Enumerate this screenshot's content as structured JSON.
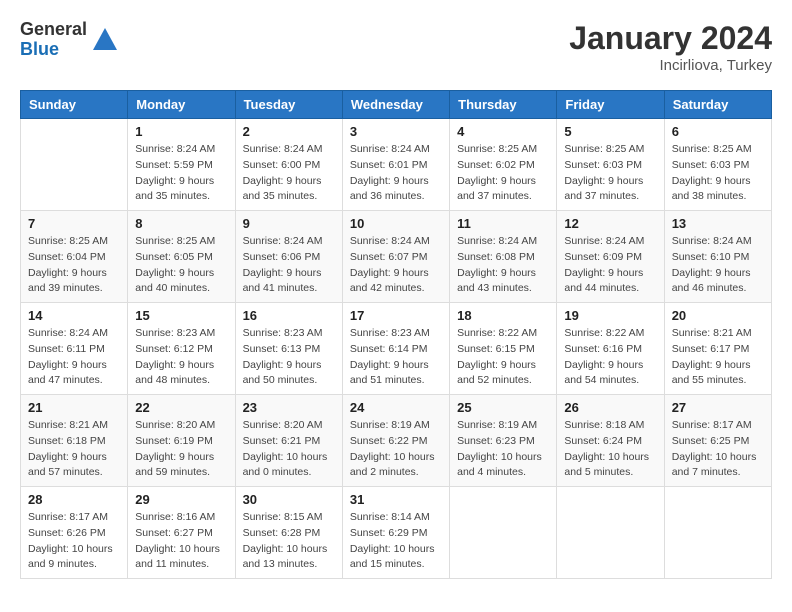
{
  "header": {
    "logo_general": "General",
    "logo_blue": "Blue",
    "month_year": "January 2024",
    "location": "Incirliova, Turkey"
  },
  "weekdays": [
    "Sunday",
    "Monday",
    "Tuesday",
    "Wednesday",
    "Thursday",
    "Friday",
    "Saturday"
  ],
  "weeks": [
    [
      {
        "day": "",
        "detail": ""
      },
      {
        "day": "1",
        "detail": "Sunrise: 8:24 AM\nSunset: 5:59 PM\nDaylight: 9 hours\nand 35 minutes."
      },
      {
        "day": "2",
        "detail": "Sunrise: 8:24 AM\nSunset: 6:00 PM\nDaylight: 9 hours\nand 35 minutes."
      },
      {
        "day": "3",
        "detail": "Sunrise: 8:24 AM\nSunset: 6:01 PM\nDaylight: 9 hours\nand 36 minutes."
      },
      {
        "day": "4",
        "detail": "Sunrise: 8:25 AM\nSunset: 6:02 PM\nDaylight: 9 hours\nand 37 minutes."
      },
      {
        "day": "5",
        "detail": "Sunrise: 8:25 AM\nSunset: 6:03 PM\nDaylight: 9 hours\nand 37 minutes."
      },
      {
        "day": "6",
        "detail": "Sunrise: 8:25 AM\nSunset: 6:03 PM\nDaylight: 9 hours\nand 38 minutes."
      }
    ],
    [
      {
        "day": "7",
        "detail": "Sunrise: 8:25 AM\nSunset: 6:04 PM\nDaylight: 9 hours\nand 39 minutes."
      },
      {
        "day": "8",
        "detail": "Sunrise: 8:25 AM\nSunset: 6:05 PM\nDaylight: 9 hours\nand 40 minutes."
      },
      {
        "day": "9",
        "detail": "Sunrise: 8:24 AM\nSunset: 6:06 PM\nDaylight: 9 hours\nand 41 minutes."
      },
      {
        "day": "10",
        "detail": "Sunrise: 8:24 AM\nSunset: 6:07 PM\nDaylight: 9 hours\nand 42 minutes."
      },
      {
        "day": "11",
        "detail": "Sunrise: 8:24 AM\nSunset: 6:08 PM\nDaylight: 9 hours\nand 43 minutes."
      },
      {
        "day": "12",
        "detail": "Sunrise: 8:24 AM\nSunset: 6:09 PM\nDaylight: 9 hours\nand 44 minutes."
      },
      {
        "day": "13",
        "detail": "Sunrise: 8:24 AM\nSunset: 6:10 PM\nDaylight: 9 hours\nand 46 minutes."
      }
    ],
    [
      {
        "day": "14",
        "detail": "Sunrise: 8:24 AM\nSunset: 6:11 PM\nDaylight: 9 hours\nand 47 minutes."
      },
      {
        "day": "15",
        "detail": "Sunrise: 8:23 AM\nSunset: 6:12 PM\nDaylight: 9 hours\nand 48 minutes."
      },
      {
        "day": "16",
        "detail": "Sunrise: 8:23 AM\nSunset: 6:13 PM\nDaylight: 9 hours\nand 50 minutes."
      },
      {
        "day": "17",
        "detail": "Sunrise: 8:23 AM\nSunset: 6:14 PM\nDaylight: 9 hours\nand 51 minutes."
      },
      {
        "day": "18",
        "detail": "Sunrise: 8:22 AM\nSunset: 6:15 PM\nDaylight: 9 hours\nand 52 minutes."
      },
      {
        "day": "19",
        "detail": "Sunrise: 8:22 AM\nSunset: 6:16 PM\nDaylight: 9 hours\nand 54 minutes."
      },
      {
        "day": "20",
        "detail": "Sunrise: 8:21 AM\nSunset: 6:17 PM\nDaylight: 9 hours\nand 55 minutes."
      }
    ],
    [
      {
        "day": "21",
        "detail": "Sunrise: 8:21 AM\nSunset: 6:18 PM\nDaylight: 9 hours\nand 57 minutes."
      },
      {
        "day": "22",
        "detail": "Sunrise: 8:20 AM\nSunset: 6:19 PM\nDaylight: 9 hours\nand 59 minutes."
      },
      {
        "day": "23",
        "detail": "Sunrise: 8:20 AM\nSunset: 6:21 PM\nDaylight: 10 hours\nand 0 minutes."
      },
      {
        "day": "24",
        "detail": "Sunrise: 8:19 AM\nSunset: 6:22 PM\nDaylight: 10 hours\nand 2 minutes."
      },
      {
        "day": "25",
        "detail": "Sunrise: 8:19 AM\nSunset: 6:23 PM\nDaylight: 10 hours\nand 4 minutes."
      },
      {
        "day": "26",
        "detail": "Sunrise: 8:18 AM\nSunset: 6:24 PM\nDaylight: 10 hours\nand 5 minutes."
      },
      {
        "day": "27",
        "detail": "Sunrise: 8:17 AM\nSunset: 6:25 PM\nDaylight: 10 hours\nand 7 minutes."
      }
    ],
    [
      {
        "day": "28",
        "detail": "Sunrise: 8:17 AM\nSunset: 6:26 PM\nDaylight: 10 hours\nand 9 minutes."
      },
      {
        "day": "29",
        "detail": "Sunrise: 8:16 AM\nSunset: 6:27 PM\nDaylight: 10 hours\nand 11 minutes."
      },
      {
        "day": "30",
        "detail": "Sunrise: 8:15 AM\nSunset: 6:28 PM\nDaylight: 10 hours\nand 13 minutes."
      },
      {
        "day": "31",
        "detail": "Sunrise: 8:14 AM\nSunset: 6:29 PM\nDaylight: 10 hours\nand 15 minutes."
      },
      {
        "day": "",
        "detail": ""
      },
      {
        "day": "",
        "detail": ""
      },
      {
        "day": "",
        "detail": ""
      }
    ]
  ]
}
